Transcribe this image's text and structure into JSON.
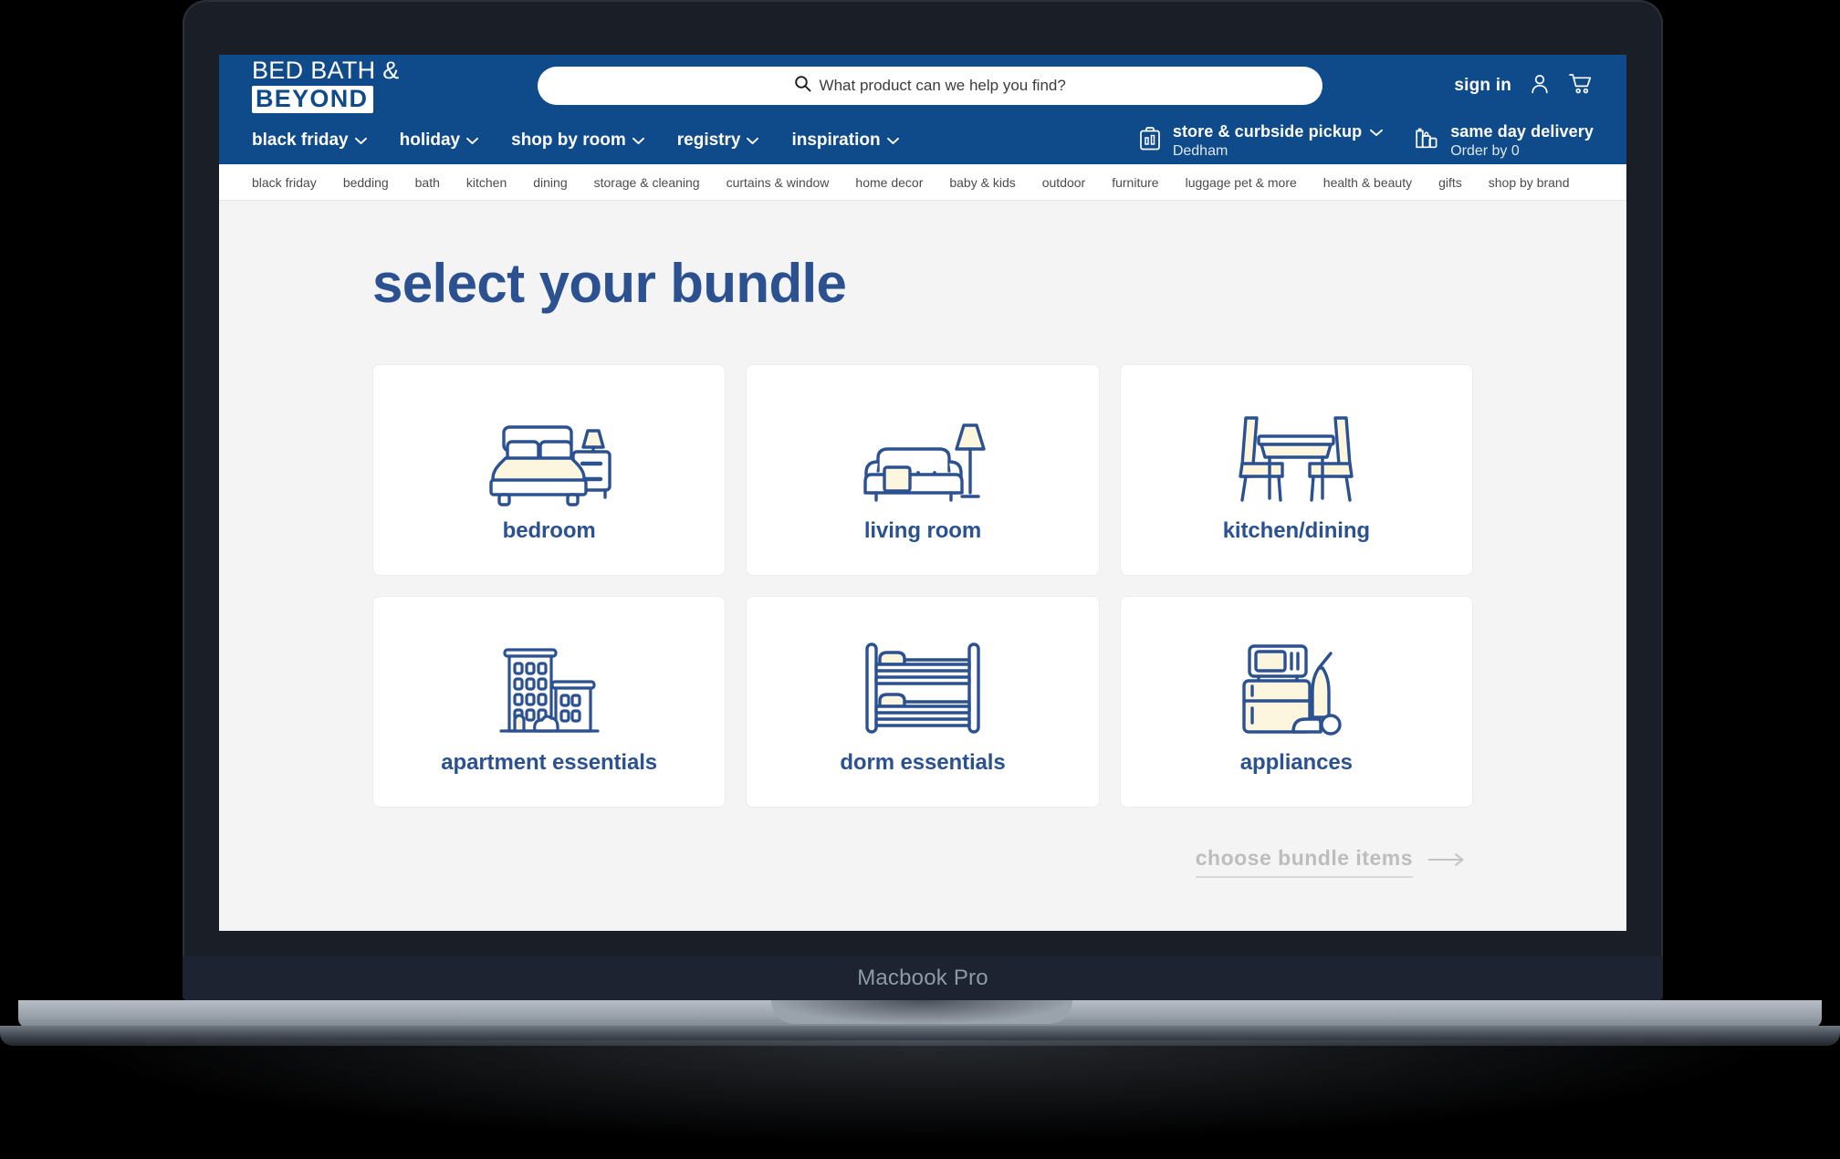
{
  "device": {
    "model_label": "Macbook Pro"
  },
  "header": {
    "brand": {
      "line1": "BED BATH &",
      "line2": "BEYOND"
    },
    "search": {
      "placeholder": "What product can we help you find?",
      "value": "",
      "icon": "search-icon"
    },
    "sign_in_label": "sign in",
    "account_icon": "user-icon",
    "cart_icon": "cart-icon",
    "nav_items": [
      {
        "label": "black friday",
        "has_dropdown": true
      },
      {
        "label": "holiday",
        "has_dropdown": true
      },
      {
        "label": "shop by room",
        "has_dropdown": true
      },
      {
        "label": "registry",
        "has_dropdown": true
      },
      {
        "label": "inspiration",
        "has_dropdown": true
      }
    ],
    "services": [
      {
        "icon": "store-pickup-icon",
        "title": "store & curbside pickup",
        "subtitle": "Dedham",
        "has_dropdown": true
      },
      {
        "icon": "same-day-delivery-icon",
        "title": "same day delivery",
        "subtitle": "Order by 0",
        "has_dropdown": false
      }
    ],
    "sub_nav_items": [
      "black friday",
      "bedding",
      "bath",
      "kitchen",
      "dining",
      "storage & cleaning",
      "curtains & window",
      "home decor",
      "baby & kids",
      "outdoor",
      "furniture",
      "luggage pet & more",
      "health & beauty",
      "gifts",
      "shop by brand"
    ]
  },
  "main": {
    "title": "select your bundle",
    "bundles": [
      {
        "label": "bedroom",
        "icon": "bed-icon"
      },
      {
        "label": "living room",
        "icon": "sofa-lamp-icon"
      },
      {
        "label": "kitchen/dining",
        "icon": "dining-table-icon"
      },
      {
        "label": "apartment essentials",
        "icon": "apartment-buildings-icon"
      },
      {
        "label": "dorm essentials",
        "icon": "bunk-bed-icon"
      },
      {
        "label": "appliances",
        "icon": "appliances-icon"
      }
    ],
    "cta": {
      "label": "choose bundle items",
      "arrow_icon": "arrow-right-icon",
      "enabled": false
    }
  },
  "colors": {
    "header_blue": "#0f4a8a",
    "brand_text_blue": "#2b5191",
    "page_background": "#f4f4f4",
    "card_background": "#ffffff",
    "icon_stroke": "#2b5191",
    "icon_fill_cream": "#fdf6de",
    "cta_disabled": "#bdbdbd"
  }
}
